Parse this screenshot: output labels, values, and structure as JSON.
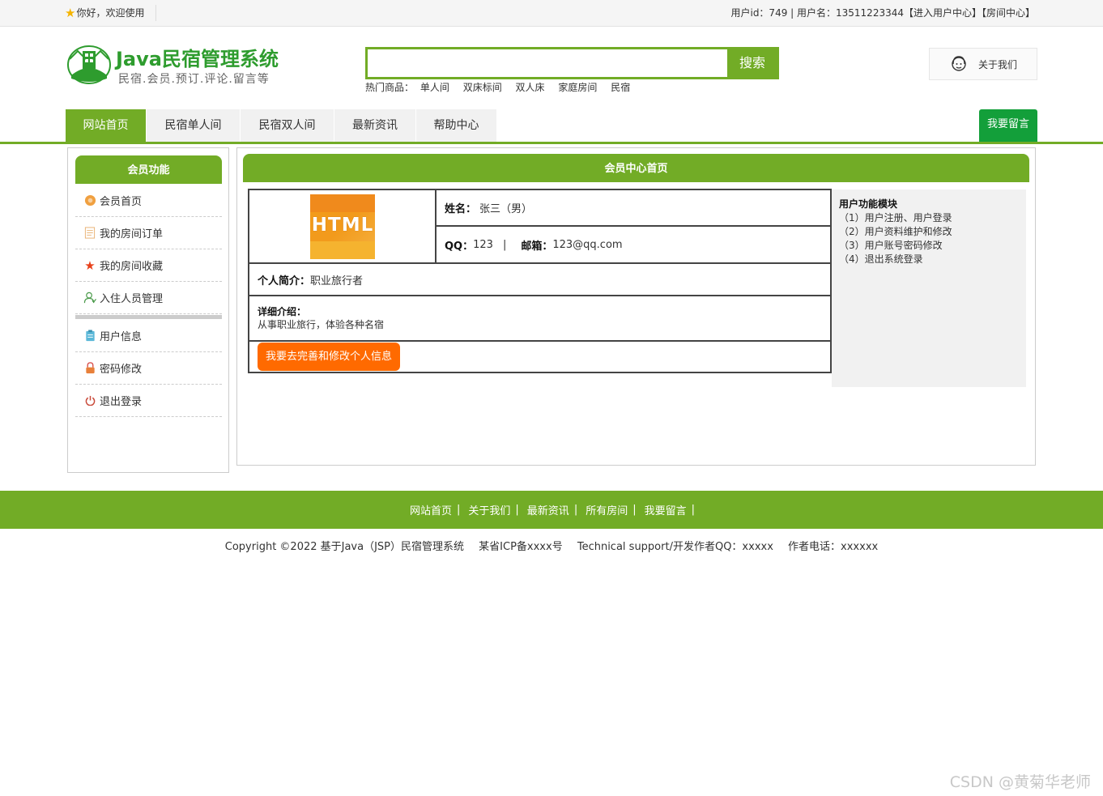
{
  "topbar": {
    "welcome": "你好，欢迎使用",
    "userinfo": "用户id：749 | 用户名：13511223344【进入用户中心】【房间中心】"
  },
  "header": {
    "title": "Java民宿管理系统",
    "subtitle": "民宿.会员.预订.评论.留言等",
    "search_value": "",
    "search_button": "搜索",
    "hot_label": "热门商品：",
    "hot_items": [
      "单人间",
      "双床标间",
      "双人床",
      "家庭房间",
      "民宿"
    ],
    "about": "关于我们"
  },
  "nav": {
    "items": [
      "网站首页",
      "民宿单人间",
      "民宿双人间",
      "最新资讯",
      "帮助中心"
    ],
    "message_button": "我要留言"
  },
  "sidebar": {
    "title": "会员功能",
    "items": [
      "会员首页",
      "我的房间订单",
      "我的房间收藏",
      "入住人员管理",
      "用户信息",
      "密码修改",
      "退出登录"
    ]
  },
  "main": {
    "title": "会员中心首页",
    "avatar_text": "HTML",
    "name_label": "姓名：",
    "name_value": "张三（男）",
    "qq_label": "QQ：",
    "qq_value": "123",
    "divider": "|",
    "email_label": "邮箱：",
    "email_value": "123@qq.com",
    "intro_label": "个人简介：",
    "intro_value": "职业旅行者",
    "detail_label": "详细介绍：",
    "detail_value": "从事职业旅行，体验各种名宿",
    "edit_button": "我要去完善和修改个人信息",
    "modules_title": "用户功能模块",
    "modules": [
      "（1）用户注册、用户登录",
      "（2）用户资料维护和修改",
      "（3）用户账号密码修改",
      "（4）退出系统登录"
    ]
  },
  "footer": {
    "links": [
      "网站首页",
      "关于我们",
      "最新资讯",
      "所有房间",
      "我要留言"
    ],
    "sep": "|",
    "copyright": "Copyright ©2022 基于Java（JSP）民宿管理系统",
    "icp": "某省ICP备xxxx号",
    "support": "Technical support/开发作者QQ：xxxxx",
    "phone": "作者电话：xxxxxx"
  },
  "watermark": "CSDN @黄菊华老师",
  "colors": {
    "brand_green": "#72ac26",
    "title_green": "#2e9c2e",
    "message_green": "#139f3a",
    "orange_button": "#ff6a00"
  }
}
